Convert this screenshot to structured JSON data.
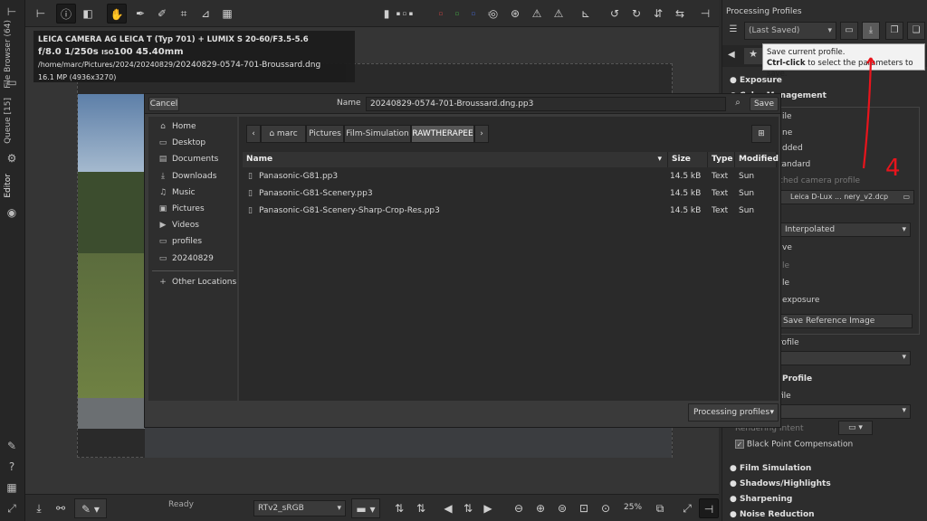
{
  "side_tabs": {
    "file_browser": "File Browser (64)",
    "queue": "Queue [15]",
    "editor": "Editor"
  },
  "image_info": {
    "camera": "LEICA CAMERA AG LEICA T (Typ 701) + LUMIX S 20-60/F3.5-5.6",
    "exposure_fnum": "f/8.0",
    "exposure_shutter": "1/250s",
    "exposure_iso_label": "ISO",
    "exposure_iso": "100",
    "exposure_focal": "45.40mm",
    "path_prefix": "/home/marc/Pictures/2024/20240829/",
    "path_file": "20240829-0574-701-Broussard.dng",
    "size": "16.1 MP (4936x3270)"
  },
  "status": {
    "ready": "Ready",
    "color_profile": "RTv2_sRGB",
    "zoom": "25%"
  },
  "right_panel": {
    "title": "Processing Profiles",
    "profile_select": "(Last Saved)",
    "sections": {
      "exposure": "Exposure",
      "color_mgmt": "Color Management",
      "film": "Film Simulation",
      "shadows": "Shadows/Highlights",
      "sharpening": "Sharpening",
      "noise": "Noise Reduction"
    },
    "partial_rows": [
      "ile",
      "ne",
      "dded",
      "tandard",
      "ched camera profile",
      "Leica D-Lux ... nery_v2.dcp",
      "Interpolated",
      "ve",
      "le",
      "exposure",
      "Save Reference Image",
      "rofile",
      "Profile",
      "file",
      "Rendering Intent",
      "Black Point Compensation"
    ]
  },
  "tooltip": {
    "line1": "Save current profile.",
    "bold": "Ctrl-click",
    "line2_rest": " to select the parameters to save."
  },
  "dialog": {
    "cancel": "Cancel",
    "name_label": "Name",
    "name_value": "20240829-0574-701-Broussard.dng.pp3",
    "save": "Save",
    "places": [
      {
        "icon": "home-icon",
        "glyph": "⌂",
        "label": "Home"
      },
      {
        "icon": "folder-icon",
        "glyph": "▭",
        "label": "Desktop"
      },
      {
        "icon": "document-icon",
        "glyph": "▤",
        "label": "Documents"
      },
      {
        "icon": "download-icon",
        "glyph": "⤓",
        "label": "Downloads"
      },
      {
        "icon": "music-icon",
        "glyph": "♫",
        "label": "Music"
      },
      {
        "icon": "picture-icon",
        "glyph": "▣",
        "label": "Pictures"
      },
      {
        "icon": "video-icon",
        "glyph": "▶",
        "label": "Videos"
      },
      {
        "icon": "folder-icon",
        "glyph": "▭",
        "label": "profiles"
      },
      {
        "icon": "folder-icon",
        "glyph": "▭",
        "label": "20240829"
      }
    ],
    "other_locations": "Other Locations",
    "breadcrumbs": [
      "marc",
      "Pictures",
      "Film-Simulation",
      "RAWTHERAPEE"
    ],
    "columns": {
      "name": "Name",
      "size": "Size",
      "type": "Type",
      "modified": "Modified"
    },
    "files": [
      {
        "name": "Panasonic-G81.pp3",
        "size": "14.5 kB",
        "type": "Text",
        "modified": "Sun"
      },
      {
        "name": "Panasonic-G81-Scenery.pp3",
        "size": "14.5 kB",
        "type": "Text",
        "modified": "Sun"
      },
      {
        "name": "Panasonic-G81-Scenery-Sharp-Crop-Res.pp3",
        "size": "14.5 kB",
        "type": "Text",
        "modified": "Sun"
      }
    ],
    "filter": "Processing profiles"
  },
  "annotation": {
    "number": "4",
    "color": "#e8141c"
  }
}
